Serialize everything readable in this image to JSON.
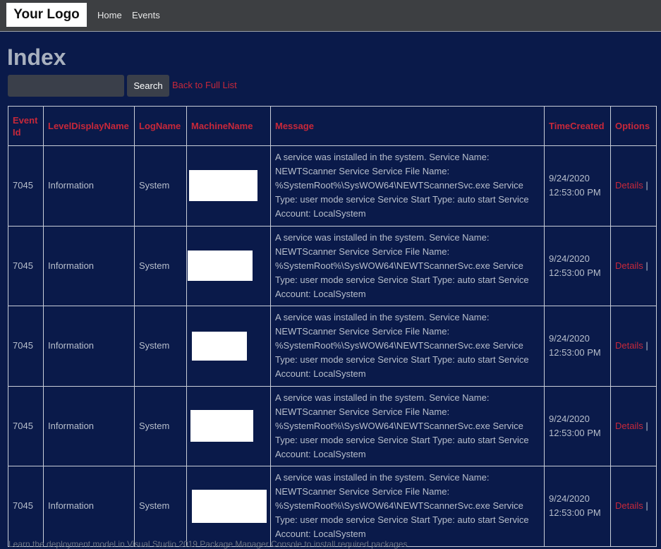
{
  "nav": {
    "logo": "Your Logo",
    "links": [
      "Home",
      "Events"
    ]
  },
  "page": {
    "title": "Index"
  },
  "search": {
    "value": "",
    "button_label": "Search",
    "back_link": "Back to Full List"
  },
  "table": {
    "headers": {
      "event_id": "Event Id",
      "level": "LevelDisplayName",
      "log": "LogName",
      "machine": "MachineName",
      "message": "Message",
      "time": "TimeCreated",
      "options": "Options"
    },
    "rows": [
      {
        "event_id": "7045",
        "level": "Information",
        "log": "System",
        "machine": "",
        "message": "A service was installed in the system. Service Name: NEWTScanner Service Service File Name: %SystemRoot%\\SysWOW64\\NEWTScannerSvc.exe Service Type: user mode service Service Start Type: auto start Service Account: LocalSystem",
        "time": "9/24/2020 12:53:00 PM",
        "details_label": "Details",
        "separator": "|"
      },
      {
        "event_id": "7045",
        "level": "Information",
        "log": "System",
        "machine": "",
        "message": "A service was installed in the system. Service Name: NEWTScanner Service Service File Name: %SystemRoot%\\SysWOW64\\NEWTScannerSvc.exe Service Type: user mode service Service Start Type: auto start Service Account: LocalSystem",
        "time": "9/24/2020 12:53:00 PM",
        "details_label": "Details",
        "separator": "|"
      },
      {
        "event_id": "7045",
        "level": "Information",
        "log": "System",
        "machine": "",
        "message": "A service was installed in the system. Service Name: NEWTScanner Service Service File Name: %SystemRoot%\\SysWOW64\\NEWTScannerSvc.exe Service Type: user mode service Service Start Type: auto start Service Account: LocalSystem",
        "time": "9/24/2020 12:53:00 PM",
        "details_label": "Details",
        "separator": "|"
      },
      {
        "event_id": "7045",
        "level": "Information",
        "log": "System",
        "machine": "",
        "message": "A service was installed in the system. Service Name: NEWTScanner Service Service File Name: %SystemRoot%\\SysWOW64\\NEWTScannerSvc.exe Service Type: user mode service Service Start Type: auto start Service Account: LocalSystem",
        "time": "9/24/2020 12:53:00 PM",
        "details_label": "Details",
        "separator": "|"
      },
      {
        "event_id": "7045",
        "level": "Information",
        "log": "System",
        "machine": "",
        "message": "A service was installed in the system. Service Name: NEWTScanner Service Service File Name: %SystemRoot%\\SysWOW64\\NEWTScannerSvc.exe Service Type: user mode service Service Start Type: auto start Service Account: LocalSystem",
        "time": "9/24/2020 12:53:00 PM",
        "details_label": "Details",
        "separator": "|"
      }
    ]
  },
  "footer": {
    "text": "Learn the deployment model in Visual Studio 2019 Package Manager Console to install required packages"
  },
  "colors": {
    "background": "#0a1a4a",
    "navbar": "#3d3f42",
    "accent_red": "#c7283a",
    "text_light": "#b8bfcc",
    "title": "#a9b1bf"
  }
}
